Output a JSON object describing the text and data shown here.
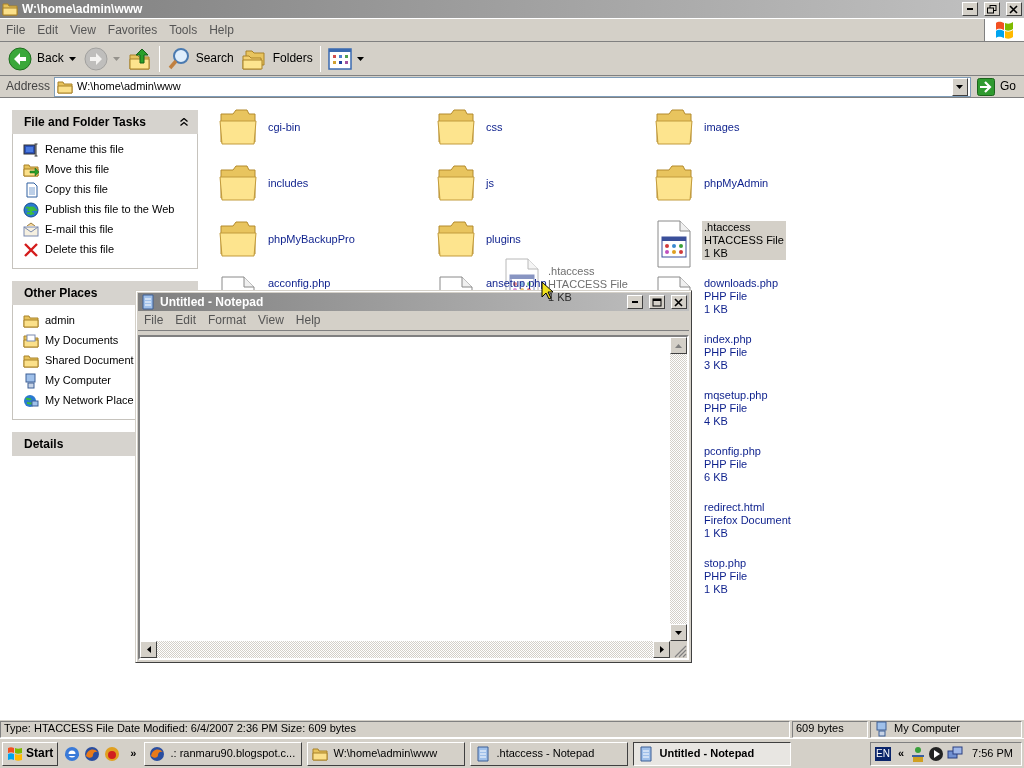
{
  "explorer": {
    "title": "W:\\home\\admin\\www",
    "menu": [
      "File",
      "Edit",
      "View",
      "Favorites",
      "Tools",
      "Help"
    ],
    "toolbar": [
      {
        "kind": "back",
        "label": "Back",
        "disabled": false
      },
      {
        "kind": "forward",
        "disabled": true
      },
      {
        "kind": "up",
        "disabled": false
      },
      {
        "kind": "search",
        "label": "Search",
        "disabled": false
      },
      {
        "kind": "folders",
        "label": "Folders",
        "disabled": false
      },
      {
        "kind": "views",
        "disabled": false
      }
    ],
    "address": {
      "label": "Address",
      "value": "W:\\home\\admin\\www",
      "go": "Go"
    }
  },
  "task_panels": [
    {
      "title": "File and Folder Tasks",
      "items": [
        {
          "kind": "rename",
          "label": "Rename this file"
        },
        {
          "kind": "move",
          "label": "Move this file"
        },
        {
          "kind": "copy",
          "label": "Copy this file"
        },
        {
          "kind": "publish",
          "label": "Publish this file to the Web"
        },
        {
          "kind": "email",
          "label": "E-mail this file"
        },
        {
          "kind": "delete",
          "label": "Delete this file"
        }
      ]
    },
    {
      "title": "Other Places",
      "items": [
        {
          "kind": "folder",
          "label": "admin"
        },
        {
          "kind": "documents",
          "label": "My Documents"
        },
        {
          "kind": "folder",
          "label": "Shared Document"
        },
        {
          "kind": "computer",
          "label": "My Computer"
        },
        {
          "kind": "network",
          "label": "My Network Place"
        }
      ]
    },
    {
      "title": "Details"
    }
  ],
  "files": [
    {
      "kind": "folder",
      "name": "cgi-bin",
      "selected": false
    },
    {
      "kind": "folder",
      "name": "css",
      "selected": false
    },
    {
      "kind": "folder",
      "name": "images",
      "selected": false
    },
    {
      "kind": "folder",
      "name": "includes",
      "selected": false
    },
    {
      "kind": "folder",
      "name": "js",
      "selected": false
    },
    {
      "kind": "folder",
      "name": "phpMyAdmin",
      "selected": false
    },
    {
      "kind": "folder",
      "name": "phpMyBackupPro",
      "selected": false
    },
    {
      "kind": "folder",
      "name": "plugins",
      "selected": false
    },
    {
      "kind": "htaccess",
      "name": ".htaccess",
      "type": "HTACCESS File",
      "size": "1 KB",
      "selected": true
    },
    {
      "kind": "php",
      "name": "acconfig.php",
      "selected": false
    },
    {
      "kind": "php",
      "name": "ansetup.php",
      "selected": false
    },
    {
      "kind": "php",
      "name": "downloads.php",
      "type": "PHP File",
      "size": "1 KB",
      "selected": false
    },
    {
      "kind": "php",
      "name": "index.php",
      "type": "PHP File",
      "size": "3 KB",
      "selected": false
    },
    {
      "kind": "php",
      "name": "mqsetup.php",
      "type": "PHP File",
      "size": "4 KB",
      "selected": false
    },
    {
      "kind": "php",
      "name": "pconfig.php",
      "type": "PHP File",
      "size": "6 KB",
      "selected": false
    },
    {
      "kind": "html",
      "name": "redirect.html",
      "type": "Firefox Document",
      "size": "1 KB",
      "selected": false
    },
    {
      "kind": "php",
      "name": "stop.php",
      "type": "PHP File",
      "size": "1 KB",
      "selected": false
    }
  ],
  "drag_ghost": {
    "name": ".htaccess",
    "type": "HTACCESS File",
    "size": "1 KB"
  },
  "notepad": {
    "title": "Untitled - Notepad",
    "menu": [
      "File",
      "Edit",
      "Format",
      "View",
      "Help"
    ]
  },
  "status_bar": {
    "details": "Type: HTACCESS File Date Modified: 6/4/2007 2:36 PM Size: 609 bytes",
    "size": "609 bytes",
    "zone": "My Computer"
  },
  "taskbar": {
    "start": "Start",
    "more": "»",
    "tasks": [
      {
        "kind": "browser",
        "label": ".: ranmaru90.blogspot.c...",
        "selected": false
      },
      {
        "kind": "folder",
        "label": "W:\\home\\admin\\www",
        "selected": false
      },
      {
        "kind": "notepad",
        "label": ".htaccess - Notepad",
        "selected": false
      },
      {
        "kind": "notepad",
        "label": "Untitled - Notepad",
        "selected": true
      }
    ],
    "tray": {
      "language": "EN",
      "expand": "«",
      "clock": "7:56 PM"
    }
  }
}
